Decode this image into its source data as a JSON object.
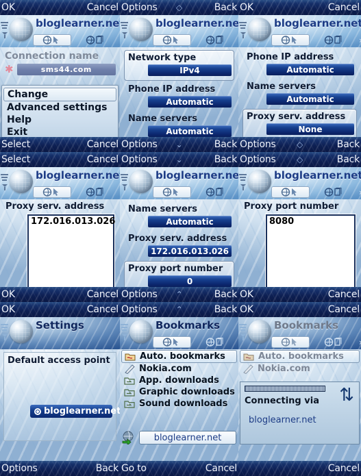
{
  "panels": [
    {
      "id": "connection-name",
      "top_softkeys": {
        "left": "OK",
        "center": "",
        "right": "Cancel"
      },
      "title": "bloglearner.net",
      "field_label": "Connection name",
      "field_value": "sms44.com",
      "menu": [
        {
          "label": "Change",
          "selected": true
        },
        {
          "label": "Advanced settings",
          "selected": false
        },
        {
          "label": "Help",
          "selected": false
        },
        {
          "label": "Exit",
          "selected": false
        }
      ],
      "bottom_softkeys": {
        "left": "Select",
        "center": "",
        "right": "Cancel"
      }
    },
    {
      "id": "network-type",
      "top_softkeys": {
        "left": "Options",
        "center": "◇",
        "right": "Back"
      },
      "title": "bloglearner.net",
      "rows": [
        {
          "label": "Network type",
          "value": "IPv4",
          "focused": true
        },
        {
          "label": "Phone IP address",
          "value": "Automatic",
          "focused": false
        },
        {
          "label": "Name servers",
          "value": "Automatic",
          "focused": false
        }
      ],
      "bottom_softkeys": {
        "left": "Options",
        "center": "⌄",
        "right": "Back"
      }
    },
    {
      "id": "proxy-serv-address-none",
      "top_softkeys": {
        "left": "OK",
        "center": "",
        "right": "Cancel"
      },
      "title": "bloglearner.net",
      "rows": [
        {
          "label": "Phone IP address",
          "value": "Automatic",
          "focused": false
        },
        {
          "label": "Name servers",
          "value": "Automatic",
          "focused": false
        },
        {
          "label": "Proxy serv. address",
          "value": "None",
          "focused": true
        }
      ],
      "bottom_softkeys": {
        "left": "Options",
        "center": "◇",
        "right": "Back"
      }
    },
    {
      "id": "proxy-serv-address-entry",
      "top_softkeys": {
        "left": "Select",
        "center": "",
        "right": "Cancel"
      },
      "title": "bloglearner.net",
      "entry_label": "Proxy serv. address",
      "entry_value": "172.016.013.026",
      "bottom_softkeys": {
        "left": "OK",
        "center": "",
        "right": "Cancel"
      }
    },
    {
      "id": "proxy-port-number-list",
      "top_softkeys": {
        "left": "Options",
        "center": "⌄",
        "right": "Back"
      },
      "title": "bloglearner.net",
      "rows": [
        {
          "label": "Name servers",
          "value": "Automatic",
          "focused": false
        },
        {
          "label": "Proxy serv. address",
          "value": "172.016.013.026",
          "focused": false
        },
        {
          "label": "Proxy port number",
          "value": "0",
          "focused": true
        }
      ],
      "bottom_softkeys": {
        "left": "Options",
        "center": "⌃",
        "right": "Back"
      }
    },
    {
      "id": "proxy-port-number-entry",
      "top_softkeys": {
        "left": "Options",
        "center": "◇",
        "right": "Back"
      },
      "title": "bloglearner.net",
      "entry_label": "Proxy port number",
      "entry_value": "8080",
      "bottom_softkeys": {
        "left": "OK",
        "center": "",
        "right": "Cancel"
      }
    },
    {
      "id": "settings-default-access-point",
      "top_softkeys": {
        "left": "OK",
        "center": "",
        "right": "Cancel"
      },
      "title": "Settings",
      "panel_title": "Default access point",
      "access_point": "bloglearner.net",
      "bottom_softkeys": {
        "left": "Options",
        "center": "",
        "right": "Back"
      }
    },
    {
      "id": "bookmarks",
      "top_softkeys": {
        "left": "Options",
        "center": "⌃",
        "right": "Back"
      },
      "title": "Bookmarks",
      "bookmarks": [
        {
          "label": "Auto. bookmarks",
          "icon": "folder-auto-icon",
          "selected": true
        },
        {
          "label": "Nokia.com",
          "icon": "nokia-bookmark-icon",
          "selected": false
        },
        {
          "label": "App. downloads",
          "icon": "folder-link-icon",
          "selected": false
        },
        {
          "label": "Graphic downloads",
          "icon": "folder-link-icon",
          "selected": false
        },
        {
          "label": "Sound downloads",
          "icon": "folder-link-icon",
          "selected": false
        }
      ],
      "url_value": "bloglearner.net",
      "bottom_softkeys": {
        "left": "Go to",
        "center": "",
        "right": "Cancel"
      }
    },
    {
      "id": "connecting",
      "top_softkeys": {
        "left": "OK",
        "center": "",
        "right": "Cancel"
      },
      "title": "Bookmarks",
      "bookmarks": [
        {
          "label": "Auto. bookmarks",
          "icon": "folder-auto-icon",
          "selected": true
        },
        {
          "label": "Nokia.com",
          "icon": "nokia-bookmark-icon",
          "selected": false
        }
      ],
      "dialog": {
        "status": "Connecting via",
        "access_point": "bloglearner.net",
        "progress_percent": 100,
        "transfer_icon": "up-down-arrows-icon"
      },
      "bottom_softkeys": {
        "left": "",
        "center": "",
        "right": "Cancel"
      }
    }
  ],
  "icons": {
    "toolbar_primary": "browser-goto-icon",
    "toolbar_secondary": "browser-pages-icon",
    "toolbar_more": "chevron-right-icon",
    "signal": "signal-bars-icon",
    "globe": "globe-icon"
  },
  "colors": {
    "value_bar": "#16408e",
    "title_text": "#1d3c86",
    "softkey_bar": "#0d1f52",
    "asterisk": "#e48a9a"
  }
}
